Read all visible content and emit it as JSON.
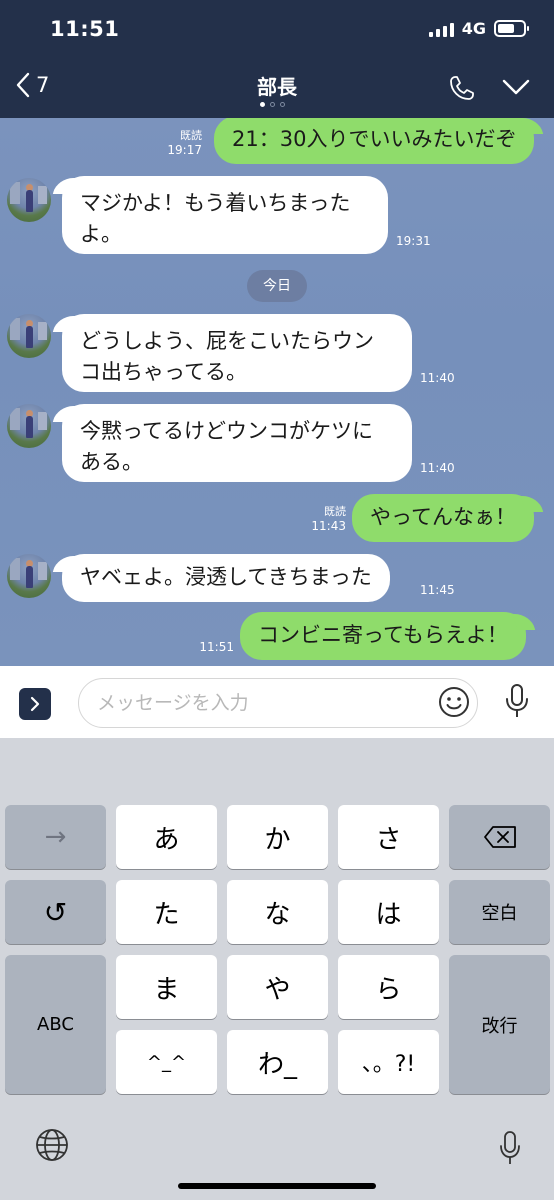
{
  "status_bar": {
    "time": "11:51",
    "network": "4G"
  },
  "nav": {
    "back_count": "7",
    "title": "部長"
  },
  "chat": {
    "messages": [
      {
        "side": "out",
        "text": "21：30入りでいいみたいだぞ",
        "read": "既読",
        "time": "19:17"
      },
      {
        "side": "in",
        "lines": [
          "マジかよ！もう着いちまった",
          "よ。"
        ],
        "time": "19:31"
      },
      {
        "side": "in",
        "lines": [
          "どうしよう、屁をこいたらウン",
          "コ出ちゃってる。"
        ],
        "time": "11:40"
      },
      {
        "side": "in",
        "lines": [
          "今黙ってるけどウンコがケツに",
          "ある。"
        ],
        "time": "11:40"
      },
      {
        "side": "out",
        "text": "やってんなぁ！",
        "read": "既読",
        "time": "11:43"
      },
      {
        "side": "in",
        "text": "ヤベェよ。浸透してきちまった",
        "time": "11:45"
      },
      {
        "side": "out",
        "text": "コンビニ寄ってもらえよ！",
        "time": "11:51"
      }
    ],
    "date_separator": "今日"
  },
  "input": {
    "placeholder": "メッセージを入力",
    "value": ""
  },
  "keyboard": {
    "keys": {
      "arrow": "→",
      "a": "あ",
      "ka": "か",
      "sa": "さ",
      "undo": "↺",
      "ta": "た",
      "na": "な",
      "ha": "は",
      "space": "空白",
      "abc": "ABC",
      "ma": "ま",
      "ya": "や",
      "ra": "ら",
      "return": "改行",
      "kaomoji": "^_^",
      "wa": "わ_",
      "punct": "、。?!"
    }
  },
  "colors": {
    "header": "#23304a",
    "chat_bg": "#7a93bc",
    "bubble_out": "#8fdc6b",
    "bubble_in": "#ffffff"
  }
}
